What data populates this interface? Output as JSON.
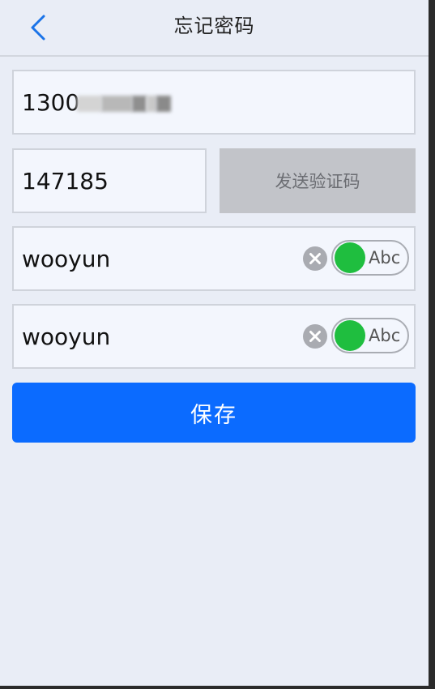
{
  "header": {
    "title": "忘记密码",
    "back_icon": "chevron-left-icon"
  },
  "phone": {
    "value_visible": "1300"
  },
  "verification": {
    "code_value": "147185",
    "send_code_label": "发送验证码"
  },
  "password": {
    "value": "wooyun",
    "toggle_label": "Abc"
  },
  "confirm_password": {
    "value": "wooyun",
    "toggle_label": "Abc"
  },
  "actions": {
    "save_label": "保存"
  },
  "colors": {
    "accent": "#0b6bff",
    "toggle_on": "#1fbe3f",
    "disabled_button": "#c2c4c9",
    "background": "#e9edf6"
  }
}
